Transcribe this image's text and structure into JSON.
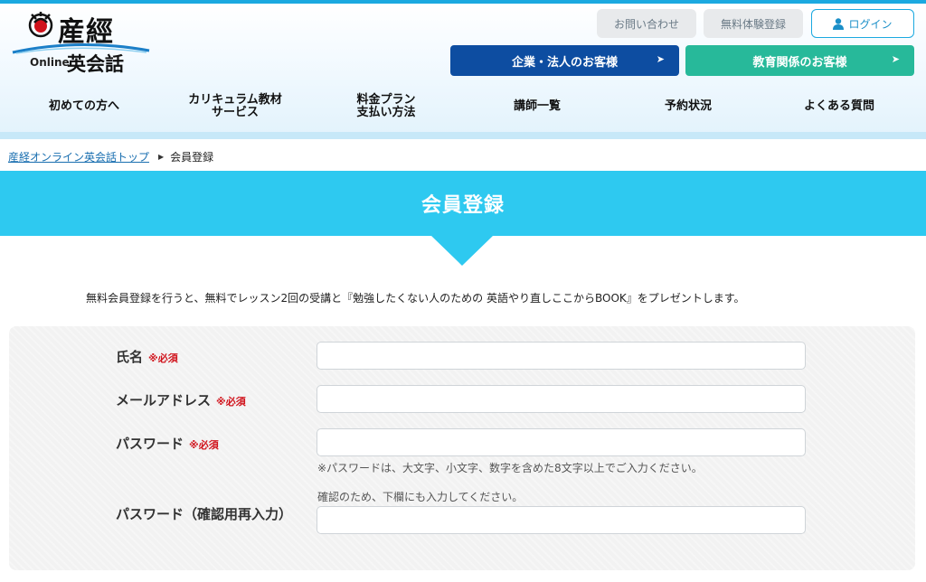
{
  "logo": {
    "sankei": "産經",
    "online": "Online",
    "eikaiwa": "英会話"
  },
  "header": {
    "contact_label": "お問い合わせ",
    "trial_label": "無料体験登録",
    "login_label": "ログイン",
    "corp_label": "企業・法人のお客様",
    "edu_label": "教育関係のお客様",
    "arrow": "➤"
  },
  "nav": {
    "items": [
      {
        "label": "初めての方へ"
      },
      {
        "label": "カリキュラム教材\nサービス"
      },
      {
        "label": "料金プラン\n支払い方法"
      },
      {
        "label": "講師一覧"
      },
      {
        "label": "予約状況"
      },
      {
        "label": "よくある質問"
      }
    ]
  },
  "breadcrumb": {
    "home": "産経オンライン英会話トップ",
    "sep": "▶",
    "current": "会員登録"
  },
  "page": {
    "title": "会員登録",
    "intro": "無料会員登録を行うと、無料でレッスン2回の受講と『勉強したくない人のための 英語やり直しここからBOOK』をプレゼントします。"
  },
  "form": {
    "required_mark": "※必須",
    "name_label": "氏名",
    "email_label": "メールアドレス",
    "password_label": "パスワード",
    "password_note": "※パスワードは、大文字、小文字、数字を含めた8文字以上でご入力ください。",
    "confirm_label": "パスワード（確認用再入力）",
    "confirm_note": "確認のため、下欄にも入力してください。",
    "name_value": "",
    "email_value": "",
    "password_value": "",
    "confirm_value": ""
  },
  "colors": {
    "accent": "#2ec9f0",
    "corp": "#0d4da1",
    "edu": "#27b99a",
    "required": "#d0121b"
  }
}
